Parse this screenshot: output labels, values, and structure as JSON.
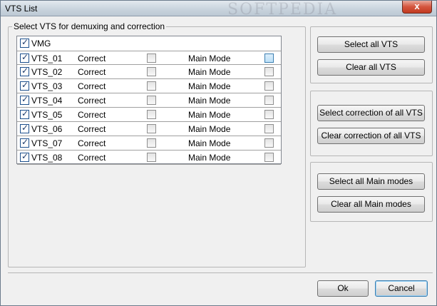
{
  "window": {
    "title": "VTS List",
    "close_glyph": "x",
    "watermark": "SOFTPEDIA"
  },
  "group": {
    "label": "Select VTS for demuxing and correction"
  },
  "vmg": {
    "label": "VMG",
    "checked": true
  },
  "rows": [
    {
      "label": "VTS_01",
      "correct_label": "Correct",
      "correct_checked": false,
      "mode_label": "Main Mode",
      "mode_checked": false,
      "mode_highlight": true
    },
    {
      "label": "VTS_02",
      "correct_label": "Correct",
      "correct_checked": false,
      "mode_label": "Main Mode",
      "mode_checked": false,
      "mode_highlight": false
    },
    {
      "label": "VTS_03",
      "correct_label": "Correct",
      "correct_checked": false,
      "mode_label": "Main Mode",
      "mode_checked": false,
      "mode_highlight": false
    },
    {
      "label": "VTS_04",
      "correct_label": "Correct",
      "correct_checked": false,
      "mode_label": "Main Mode",
      "mode_checked": false,
      "mode_highlight": false
    },
    {
      "label": "VTS_05",
      "correct_label": "Correct",
      "correct_checked": false,
      "mode_label": "Main Mode",
      "mode_checked": false,
      "mode_highlight": false
    },
    {
      "label": "VTS_06",
      "correct_label": "Correct",
      "correct_checked": false,
      "mode_label": "Main Mode",
      "mode_checked": false,
      "mode_highlight": false
    },
    {
      "label": "VTS_07",
      "correct_label": "Correct",
      "correct_checked": false,
      "mode_label": "Main Mode",
      "mode_checked": false,
      "mode_highlight": false
    },
    {
      "label": "VTS_08",
      "correct_label": "Correct",
      "correct_checked": false,
      "mode_label": "Main Mode",
      "mode_checked": false,
      "mode_highlight": false
    }
  ],
  "buttons": {
    "select_all_vts": "Select all VTS",
    "clear_all_vts": "Clear all VTS",
    "select_correction": "Select correction of all VTS",
    "clear_correction": "Clear correction of all VTS",
    "select_main_modes": "Select all Main modes",
    "clear_main_modes": "Clear all Main modes",
    "ok": "Ok",
    "cancel": "Cancel"
  }
}
